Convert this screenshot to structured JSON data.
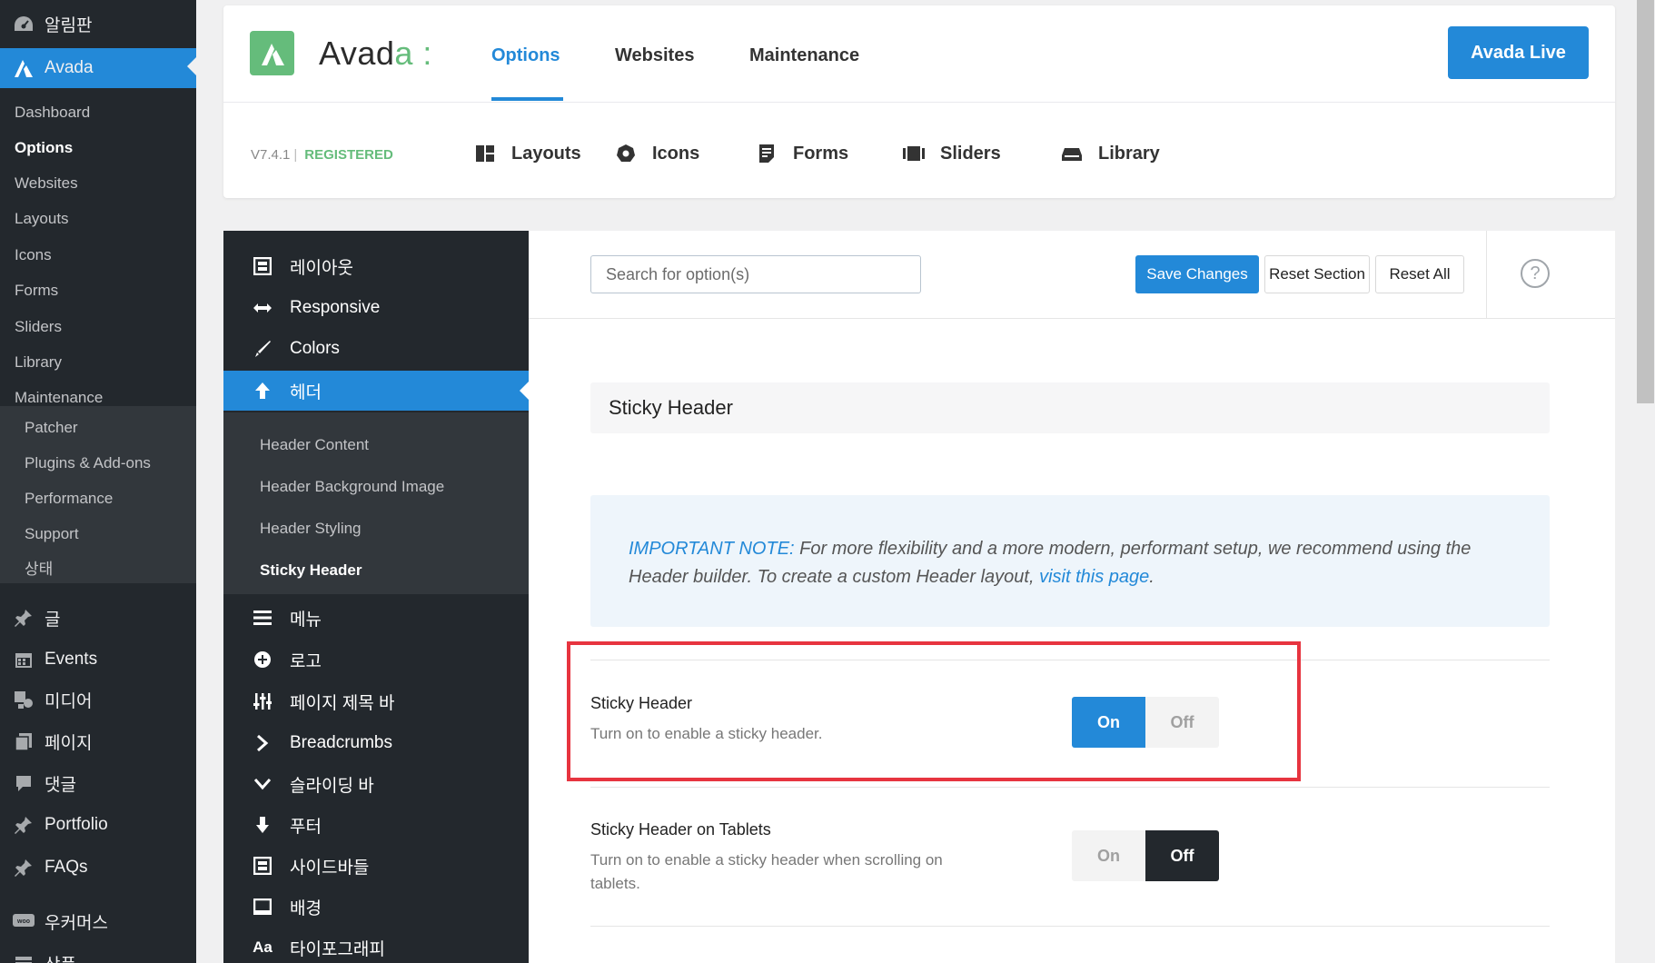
{
  "wp_menu": {
    "dashboard": "알림판",
    "avada": "Avada",
    "avada_sub": [
      "Dashboard",
      "Options",
      "Websites",
      "Layouts",
      "Icons",
      "Forms",
      "Sliders",
      "Library",
      "Maintenance"
    ],
    "avada_sub_current": "Options",
    "tools_sub": [
      "Patcher",
      "Plugins & Add-ons",
      "Performance",
      "Support",
      "상태"
    ],
    "items": [
      "글",
      "Events",
      "미디어",
      "페이지",
      "댓글",
      "Portfolio",
      "FAQs",
      "우커머스",
      "상품"
    ]
  },
  "header": {
    "logo_text_main": "Avad",
    "logo_text_accent": "a :",
    "nav": [
      "Options",
      "Websites",
      "Maintenance"
    ],
    "nav_active": "Options",
    "live_button": "Avada Live",
    "version": "V7.4.1",
    "version_sep": "|",
    "registered": "REGISTERED",
    "sub_nav": [
      "Layouts",
      "Icons",
      "Forms",
      "Sliders",
      "Library"
    ]
  },
  "options_sidebar": {
    "items_top": [
      "레이아웃",
      "Responsive",
      "Colors",
      "헤더"
    ],
    "active": "헤더",
    "sub_items": [
      "Header Content",
      "Header Background Image",
      "Header Styling",
      "Sticky Header"
    ],
    "sub_current": "Sticky Header",
    "items_bottom": [
      "메뉴",
      "로고",
      "페이지 제목 바",
      "Breadcrumbs",
      "슬라이딩 바",
      "푸터",
      "사이드바들",
      "배경",
      "타이포그래피"
    ]
  },
  "toolbar": {
    "search_placeholder": "Search for option(s)",
    "save": "Save Changes",
    "reset_section": "Reset Section",
    "reset_all": "Reset All",
    "help": "?"
  },
  "section": {
    "title": "Sticky Header",
    "note_label": "IMPORTANT NOTE:",
    "note_text": " For more flexibility and a more modern, performant setup, we recommend using the Header builder. To create a custom Header layout, ",
    "note_link": "visit this page",
    "note_end": "."
  },
  "options": [
    {
      "title": "Sticky Header",
      "desc": "Turn on to enable a sticky header.",
      "on": "On",
      "off": "Off",
      "value": "On"
    },
    {
      "title": "Sticky Header on Tablets",
      "desc": "Turn on to enable a sticky header when scrolling on tablets.",
      "on": "On",
      "off": "Off",
      "value": "Off"
    }
  ],
  "colors": {
    "accent": "#2389d8",
    "brand_green": "#65bc7b",
    "admin_dark": "#23282d",
    "highlight": "#e7343f"
  }
}
